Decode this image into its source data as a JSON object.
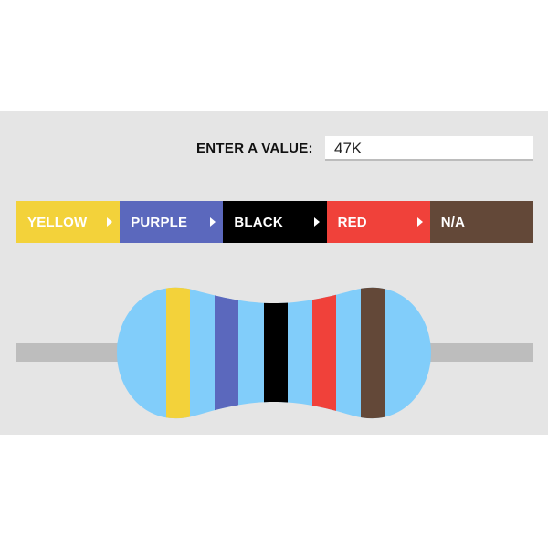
{
  "form": {
    "label": "ENTER A VALUE:",
    "value": "47K"
  },
  "bands": [
    {
      "label": "YELLOW",
      "color": "#f3d23a",
      "has_caret": true
    },
    {
      "label": "PURPLE",
      "color": "#5b68bd",
      "has_caret": true
    },
    {
      "label": "BLACK",
      "color": "#000000",
      "has_caret": true
    },
    {
      "label": "RED",
      "color": "#f0413a",
      "has_caret": true
    },
    {
      "label": "N/A",
      "color": "#634838",
      "has_caret": false
    }
  ],
  "resistor": {
    "body_color": "#81cdfa",
    "lead_color": "#bdbdbd",
    "stripes": [
      {
        "name": "yellow",
        "color": "#f3d23a"
      },
      {
        "name": "purple",
        "color": "#5b68bd"
      },
      {
        "name": "black",
        "color": "#000000"
      },
      {
        "name": "red",
        "color": "#f0413a"
      },
      {
        "name": "brown",
        "color": "#634838"
      }
    ]
  }
}
